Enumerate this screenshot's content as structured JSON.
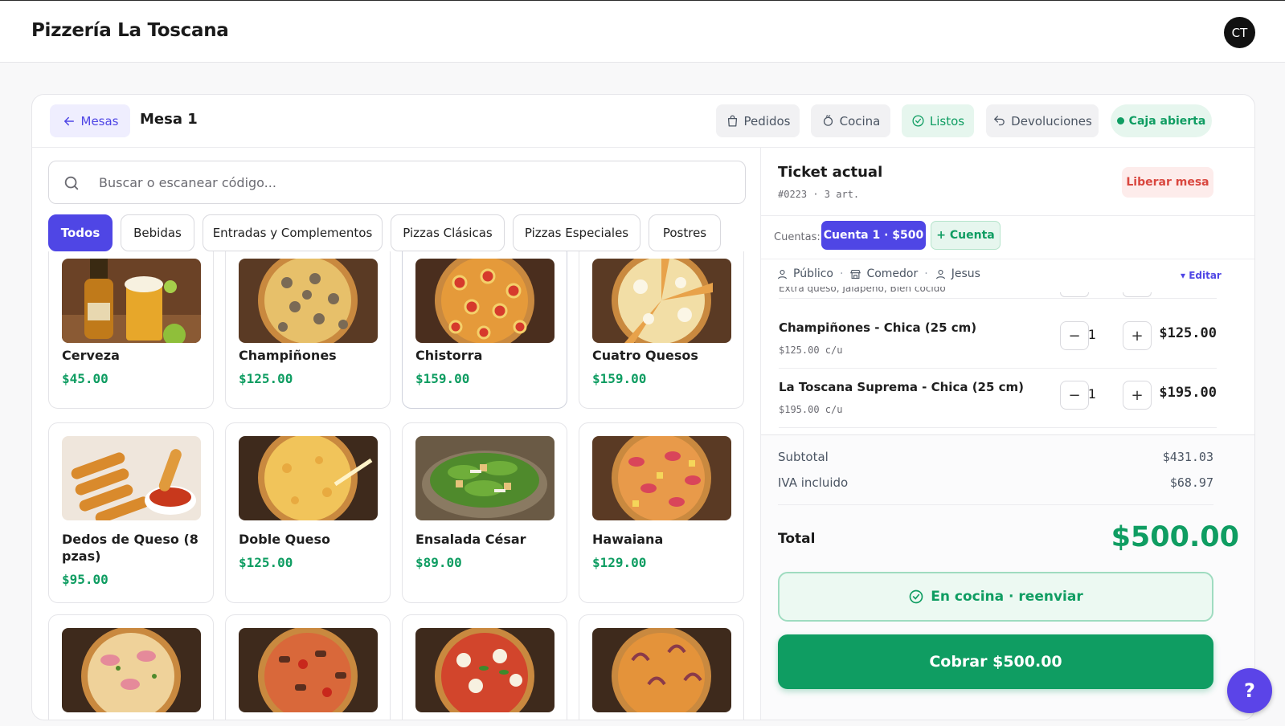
{
  "app": {
    "title": "Pizzería La Toscana",
    "user_initials": "CT"
  },
  "header": {
    "back_label": "Mesas",
    "table_title": "Mesa 1",
    "buttons": [
      {
        "label": "Pedidos",
        "icon": "shopping-bag-icon"
      },
      {
        "label": "Cocina",
        "icon": "cooking-pot-icon"
      },
      {
        "label": "Listos",
        "icon": "check-circle-icon"
      },
      {
        "label": "Devoluciones",
        "icon": "undo-icon"
      }
    ],
    "status_label": "Caja abierta"
  },
  "search": {
    "placeholder": "Buscar o escanear código...",
    "value": ""
  },
  "categories": [
    "Todos",
    "Bebidas",
    "Entradas y Complementos",
    "Pizzas Clásicas",
    "Pizzas Especiales",
    "Postres"
  ],
  "products": [
    {
      "name": "Cerveza",
      "price": "$45.00",
      "image": "beer"
    },
    {
      "name": "Champiñones",
      "price": "$125.00",
      "image": "mushroom-pizza"
    },
    {
      "name": "Chistorra",
      "price": "$159.00",
      "image": "chistorra-pizza"
    },
    {
      "name": "Cuatro Quesos",
      "price": "$159.00",
      "image": "four-cheese-pizza"
    },
    {
      "name": "Dedos de Queso (8 pzas)",
      "price": "$95.00",
      "image": "cheese-sticks"
    },
    {
      "name": "Doble Queso",
      "price": "$125.00",
      "image": "cheese-pizza"
    },
    {
      "name": "Ensalada César",
      "price": "$89.00",
      "image": "caesar-salad"
    },
    {
      "name": "Hawaiana",
      "price": "$129.00",
      "image": "hawaiian-pizza"
    },
    {
      "name": "",
      "price": "",
      "image": "ham-pizza"
    },
    {
      "name": "",
      "price": "",
      "image": "sausage-pizza"
    },
    {
      "name": "",
      "price": "",
      "image": "margherita-pizza"
    },
    {
      "name": "",
      "price": "",
      "image": "seafood-pizza"
    }
  ],
  "ticket": {
    "title": "Ticket actual",
    "subtitle": "#0223 · 3 art.",
    "release_label": "Liberar mesa",
    "accounts_label": "Cuentas:",
    "active_account": "Cuenta 1 · $500",
    "add_account": "+ Cuenta",
    "meta": {
      "audience": "Público",
      "area": "Comedor",
      "waiter": "Jesus",
      "edit_label": "▾ Editar"
    },
    "cut_note": "Extra queso, Jalapeño, Bien cocido",
    "items": [
      {
        "name": "Champiñones - Chica (25 cm)",
        "unit": "$125.00 c/u",
        "qty": "1",
        "total": "$125.00"
      },
      {
        "name": "La Toscana Suprema - Chica (25 cm)",
        "unit": "$195.00 c/u",
        "qty": "1",
        "total": "$195.00"
      }
    ],
    "subtotal_label": "Subtotal",
    "subtotal": "$431.03",
    "iva_label": "IVA incluido",
    "iva": "$68.97",
    "total_label": "Total",
    "total": "$500.00",
    "kitchen_label": "En cocina · reenviar",
    "charge_label": "Cobrar $500.00"
  },
  "help_label": "?",
  "colors": {
    "accent": "#4f46e5",
    "success": "#0f9d62",
    "danger": "#d9473f"
  }
}
